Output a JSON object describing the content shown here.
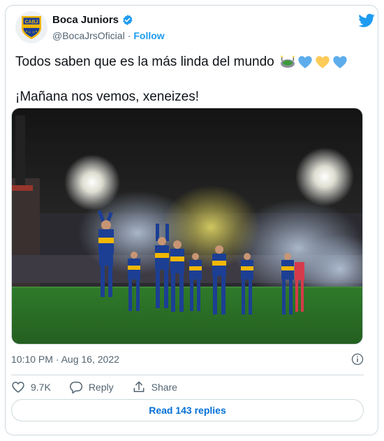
{
  "author": {
    "name": "Boca Juniors",
    "handle": "@BocaJrsOficial",
    "follow_label": "Follow",
    "logo_text": "CABJ"
  },
  "tweet": {
    "line1": "Todos saben que es la más linda del mundo",
    "line1_emojis": [
      "stadium-emoji",
      "blue-heart-emoji",
      "yellow-heart-emoji",
      "blue-heart-emoji"
    ],
    "line2": "¡Mañana nos vemos, xeneizes!",
    "timestamp": "10:10 PM · Aug 16, 2022"
  },
  "actions": {
    "likes": "9.7K",
    "reply_label": "Reply",
    "share_label": "Share"
  },
  "read_replies_label": "Read 143 replies",
  "colors": {
    "twitter_blue": "#1d9bf0",
    "boca_blue": "#1c3f94",
    "boca_gold": "#f2b705"
  }
}
